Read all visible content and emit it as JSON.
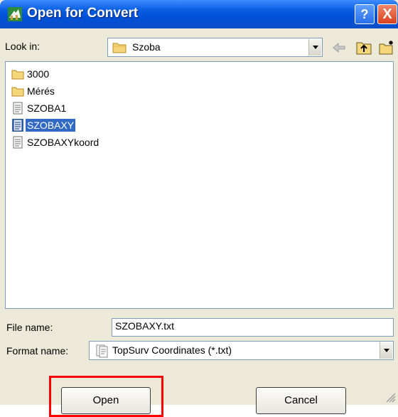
{
  "window": {
    "title": "Open for Convert"
  },
  "title_buttons": {
    "help": "?",
    "close": "X"
  },
  "look_in": {
    "label": "Look in:",
    "value": "Szoba"
  },
  "files": [
    {
      "name": "3000",
      "type": "folder",
      "selected": false
    },
    {
      "name": "Mérés",
      "type": "folder",
      "selected": false
    },
    {
      "name": "SZOBA1",
      "type": "file",
      "selected": false
    },
    {
      "name": "SZOBAXY",
      "type": "file",
      "selected": true
    },
    {
      "name": "SZOBAXYkoord",
      "type": "file",
      "selected": false
    }
  ],
  "file_name": {
    "label": "File name:",
    "value": "SZOBAXY.txt"
  },
  "format_name": {
    "label": "Format name:",
    "value": "TopSurv Coordinates (*.txt)"
  },
  "buttons": {
    "open": "Open",
    "cancel": "Cancel"
  },
  "colors": {
    "selection": "#316ac5",
    "highlight_box": "#ff0000",
    "titlebar": "#0a5fe0"
  }
}
